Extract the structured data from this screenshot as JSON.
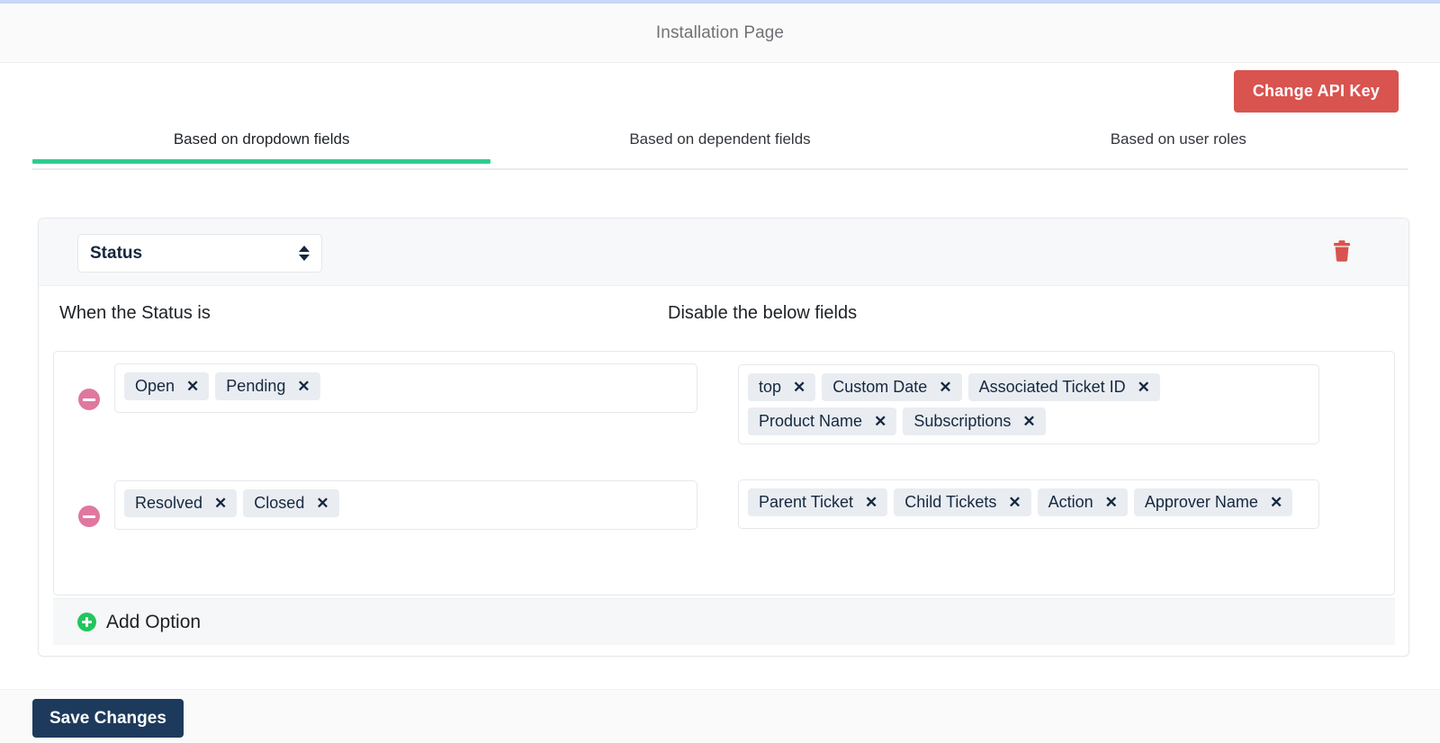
{
  "header": {
    "title": "Installation Page"
  },
  "actions": {
    "change_api_key_label": "Change API Key",
    "save_changes_label": "Save Changes"
  },
  "tabs": [
    {
      "label": "Based on dropdown fields",
      "active": true
    },
    {
      "label": "Based on dependent fields",
      "active": false
    },
    {
      "label": "Based on user roles",
      "active": false
    }
  ],
  "card": {
    "field_select": {
      "value": "Status",
      "icon": "stepper-updown-icon"
    },
    "delete_icon": "trash-icon",
    "columns": {
      "left_title": "When the Status is",
      "right_title": "Disable the below fields"
    },
    "rules": [
      {
        "remove_icon": "minus-circle-icon",
        "conditions": [
          "Open",
          "Pending"
        ],
        "disabled_fields": [
          "top",
          "Custom Date",
          "Associated Ticket ID",
          "Product Name",
          "Subscriptions"
        ]
      },
      {
        "remove_icon": "minus-circle-icon",
        "conditions": [
          "Resolved",
          "Closed"
        ],
        "disabled_fields": [
          "Parent Ticket",
          "Child Tickets",
          "Action",
          "Approver Name"
        ]
      }
    ],
    "add_option": {
      "label": "Add Option",
      "icon": "plus-circle-icon"
    }
  },
  "colors": {
    "accent_green": "#2ecc8f",
    "danger_red": "#d9534f",
    "save_navy": "#1d3a5c",
    "tag_bg": "#e9edf2",
    "tag_text": "#16283f",
    "minus_pink": "#e0779e",
    "plus_green": "#22c55e",
    "top_strip": "#c8d7f7"
  },
  "tag_close_glyph": "✕"
}
